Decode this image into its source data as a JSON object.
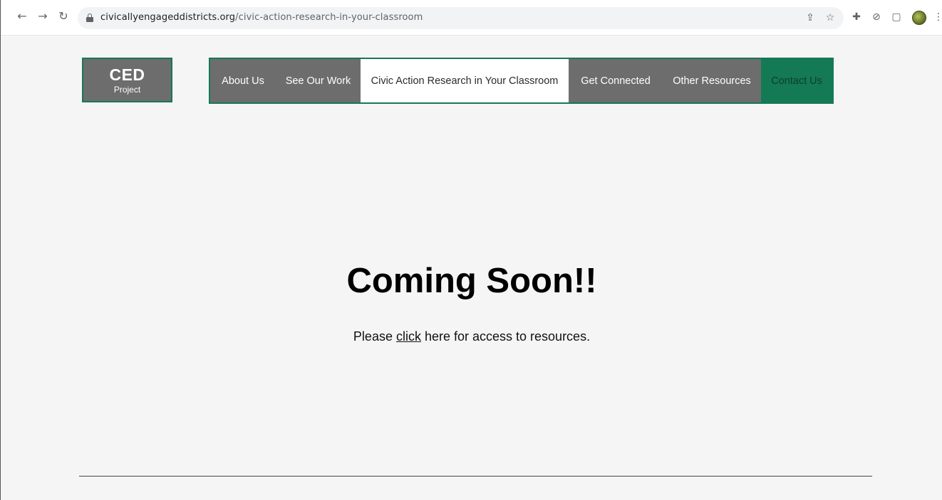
{
  "browser": {
    "url_domain": "civicallyengageddistricts.org",
    "url_path": "/civic-action-research-in-your-classroom",
    "icons": {
      "back": "back-arrow-icon",
      "forward": "forward-arrow-icon",
      "reload": "reload-icon",
      "lock": "lock-icon",
      "share": "share-icon",
      "bookmark": "star-icon",
      "extensions": "puzzle-icon",
      "extension2": "extension-icon",
      "sidepanel": "side-panel-icon",
      "profile": "avatar",
      "menu": "kebab-menu-icon"
    }
  },
  "site": {
    "logo": {
      "title": "CED",
      "subtitle": "Project"
    },
    "nav": {
      "items": [
        {
          "label": "About Us"
        },
        {
          "label": "See Our Work"
        },
        {
          "label": "Civic Action Research in Your Classroom",
          "active": true
        },
        {
          "label": "Get Connected"
        },
        {
          "label": "Other Resources"
        },
        {
          "label": "Contact Us",
          "accent": true
        }
      ]
    },
    "colors": {
      "nav_background": "#6d6d6d",
      "accent_green": "#137a55",
      "active_tab_background": "#ffffff",
      "page_background": "#f5f5f5"
    }
  },
  "main": {
    "heading": "Coming Soon!!",
    "paragraph": {
      "before": "Please ",
      "link": "click",
      "after": " here for access to resources."
    }
  }
}
